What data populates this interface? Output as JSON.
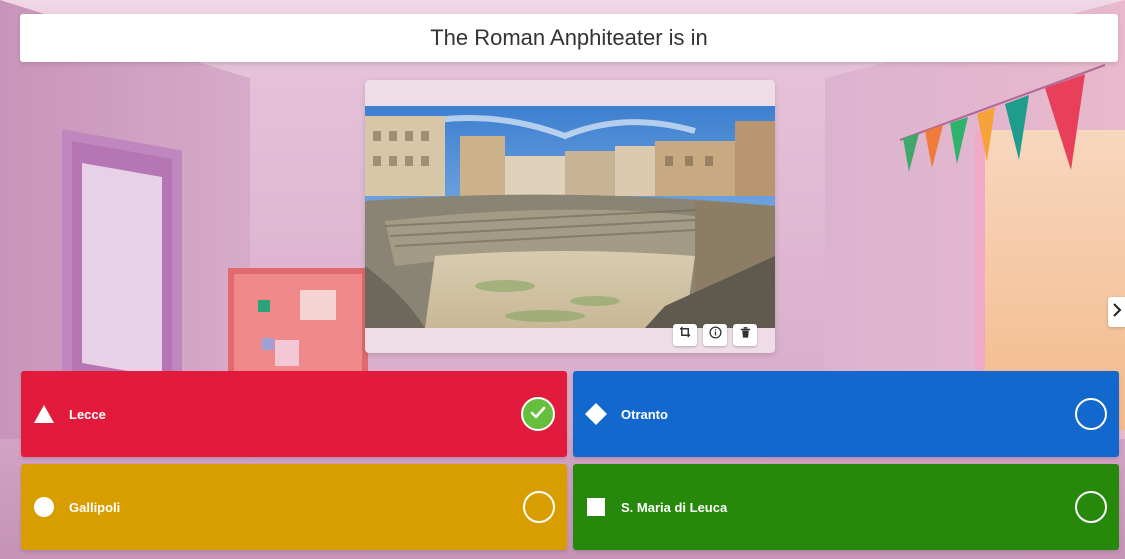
{
  "question": {
    "text": "The Roman Anphiteater is in"
  },
  "media": {
    "tools": [
      {
        "icon": "crop-icon"
      },
      {
        "icon": "info-icon"
      },
      {
        "icon": "trash-icon"
      }
    ]
  },
  "navigation": {
    "next_icon": "chevron-right-icon"
  },
  "answers": [
    {
      "label": "Lecce",
      "shape": "triangle",
      "color": "#e21b3c",
      "correct": true
    },
    {
      "label": "Otranto",
      "shape": "diamond",
      "color": "#1368ce",
      "correct": false
    },
    {
      "label": "Gallipoli",
      "shape": "circle",
      "color": "#d89e00",
      "correct": false
    },
    {
      "label": "S. Maria di Leuca",
      "shape": "square",
      "color": "#26890c",
      "correct": false
    }
  ]
}
